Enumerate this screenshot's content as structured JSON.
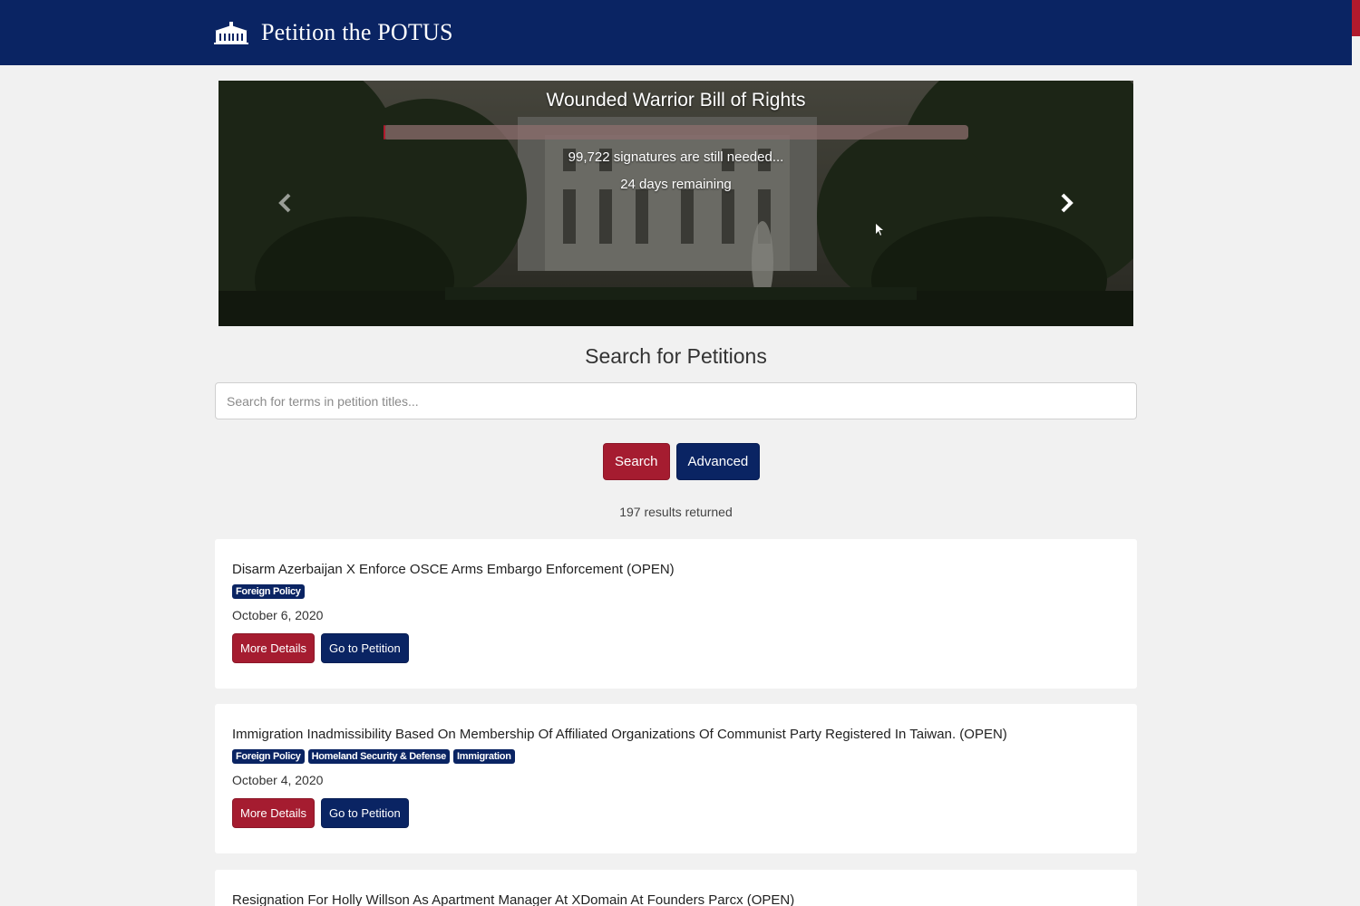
{
  "header": {
    "brand": "Petition the POTUS",
    "brand_icon": "white-house-icon"
  },
  "carousel": {
    "title": "Wounded Warrior Bill of Rights",
    "progress_fraction": 0.003,
    "signatures_needed": "99,722 signatures are still needed...",
    "days_remaining": "24 days remaining",
    "prev_icon": "chevron-left-icon",
    "next_icon": "chevron-right-icon"
  },
  "search": {
    "heading": "Search for Petitions",
    "placeholder": "Search for terms in petition titles...",
    "search_label": "Search",
    "advanced_label": "Advanced",
    "results": "197 results returned"
  },
  "petitions": [
    {
      "title": "Disarm Azerbaijan X Enforce OSCE Arms Embargo Enforcement (OPEN)",
      "tags": [
        "Foreign Policy"
      ],
      "date": "October 6, 2020",
      "details_label": "More Details",
      "go_label": "Go to Petition"
    },
    {
      "title": "Immigration Inadmissibility Based On Membership Of Affiliated Organizations Of Communist Party Registered In Taiwan. (OPEN)",
      "tags": [
        "Foreign Policy",
        "Homeland Security & Defense",
        "Immigration"
      ],
      "date": "October 4, 2020",
      "details_label": "More Details",
      "go_label": "Go to Petition"
    },
    {
      "title": "Resignation For Holly Willson As Apartment Manager At XDomain At Founders Parcx (OPEN)"
    }
  ],
  "colors": {
    "navy": "#0a2463",
    "red": "#a51c30",
    "background": "#f1f1f1"
  }
}
